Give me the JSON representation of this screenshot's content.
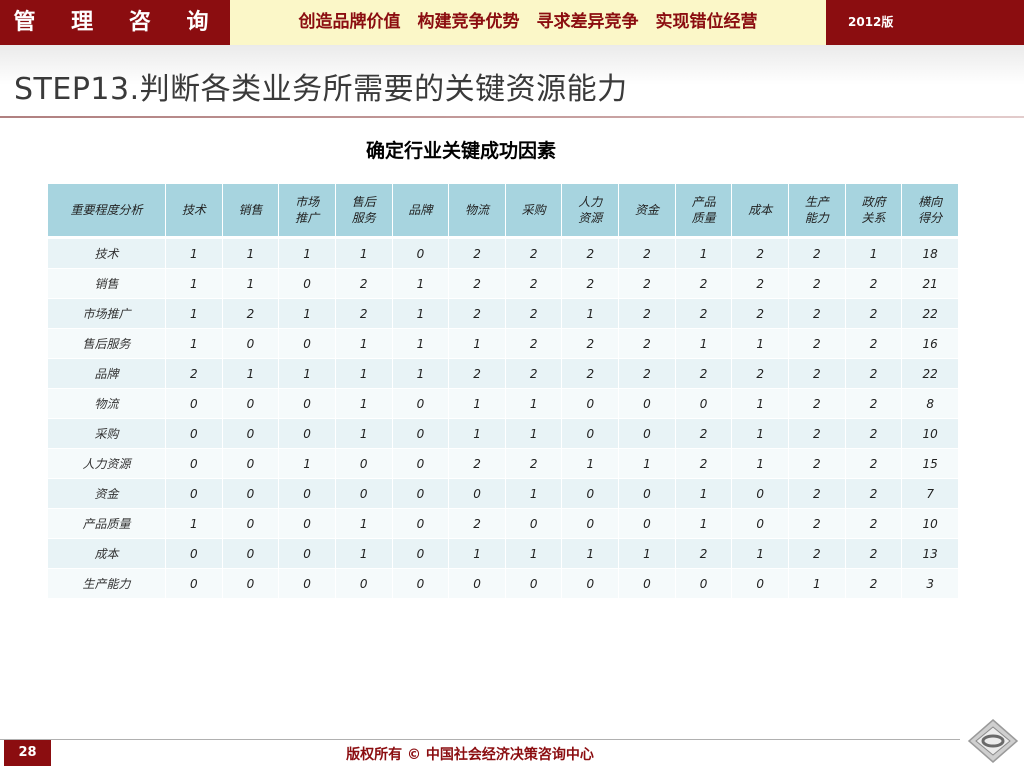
{
  "header": {
    "brand": "管 理 咨 询",
    "slogan": "创造品牌价值　构建竞争优势　寻求差异竞争　实现错位经营",
    "edition": "2012版"
  },
  "page": {
    "title": "STEP13.判断各类业务所需要的关键资源能力",
    "subtitle": "确定行业关键成功因素"
  },
  "table": {
    "corner": "重要程度分析",
    "columns": [
      [
        "技术"
      ],
      [
        "销售"
      ],
      [
        "市场",
        "推广"
      ],
      [
        "售后",
        "服务"
      ],
      [
        "品牌"
      ],
      [
        "物流"
      ],
      [
        "采购"
      ],
      [
        "人力",
        "资源"
      ],
      [
        "资金"
      ],
      [
        "产品",
        "质量"
      ],
      [
        "成本"
      ],
      [
        "生产",
        "能力"
      ],
      [
        "政府",
        "关系"
      ],
      [
        "横向",
        "得分"
      ]
    ],
    "rows": [
      {
        "label": "技术",
        "values": [
          "1",
          "1",
          "1",
          "1",
          "0",
          "2",
          "2",
          "2",
          "2",
          "1",
          "2",
          "2",
          "1",
          "18"
        ]
      },
      {
        "label": "销售",
        "values": [
          "1",
          "1",
          "0",
          "2",
          "1",
          "2",
          "2",
          "2",
          "2",
          "2",
          "2",
          "2",
          "2",
          "21"
        ]
      },
      {
        "label": "市场推广",
        "values": [
          "1",
          "2",
          "1",
          "2",
          "1",
          "2",
          "2",
          "1",
          "2",
          "2",
          "2",
          "2",
          "2",
          "22"
        ]
      },
      {
        "label": "售后服务",
        "values": [
          "1",
          "0",
          "0",
          "1",
          "1",
          "1",
          "2",
          "2",
          "2",
          "1",
          "1",
          "2",
          "2",
          "16"
        ]
      },
      {
        "label": "品牌",
        "values": [
          "2",
          "1",
          "1",
          "1",
          "1",
          "2",
          "2",
          "2",
          "2",
          "2",
          "2",
          "2",
          "2",
          "22"
        ]
      },
      {
        "label": "物流",
        "values": [
          "0",
          "0",
          "0",
          "1",
          "0",
          "1",
          "1",
          "0",
          "0",
          "0",
          "1",
          "2",
          "2",
          "8"
        ]
      },
      {
        "label": "采购",
        "values": [
          "0",
          "0",
          "0",
          "1",
          "0",
          "1",
          "1",
          "0",
          "0",
          "2",
          "1",
          "2",
          "2",
          "10"
        ]
      },
      {
        "label": "人力资源",
        "values": [
          "0",
          "0",
          "1",
          "0",
          "0",
          "2",
          "2",
          "1",
          "1",
          "2",
          "1",
          "2",
          "2",
          "15"
        ]
      },
      {
        "label": "资金",
        "values": [
          "0",
          "0",
          "0",
          "0",
          "0",
          "0",
          "1",
          "0",
          "0",
          "1",
          "0",
          "2",
          "2",
          "7"
        ]
      },
      {
        "label": "产品质量",
        "values": [
          "1",
          "0",
          "0",
          "1",
          "0",
          "2",
          "0",
          "0",
          "0",
          "1",
          "0",
          "2",
          "2",
          "10"
        ]
      },
      {
        "label": "成本",
        "values": [
          "0",
          "0",
          "0",
          "1",
          "0",
          "1",
          "1",
          "1",
          "1",
          "2",
          "1",
          "2",
          "2",
          "13"
        ]
      },
      {
        "label": "生产能力",
        "values": [
          "0",
          "0",
          "0",
          "0",
          "0",
          "0",
          "0",
          "0",
          "0",
          "0",
          "0",
          "1",
          "2",
          "3"
        ]
      }
    ]
  },
  "footer": {
    "page_number": "28",
    "copyright": "版权所有 © 中国社会经济决策咨询中心"
  },
  "colors": {
    "brand_red": "#8b0d10",
    "slogan_bg": "#fbf7c8",
    "table_header": "#a7d4df",
    "row_odd": "#e8f3f6",
    "row_even": "#f5fafb"
  },
  "icons": {
    "logo": "diamond-ring-logo-icon"
  }
}
